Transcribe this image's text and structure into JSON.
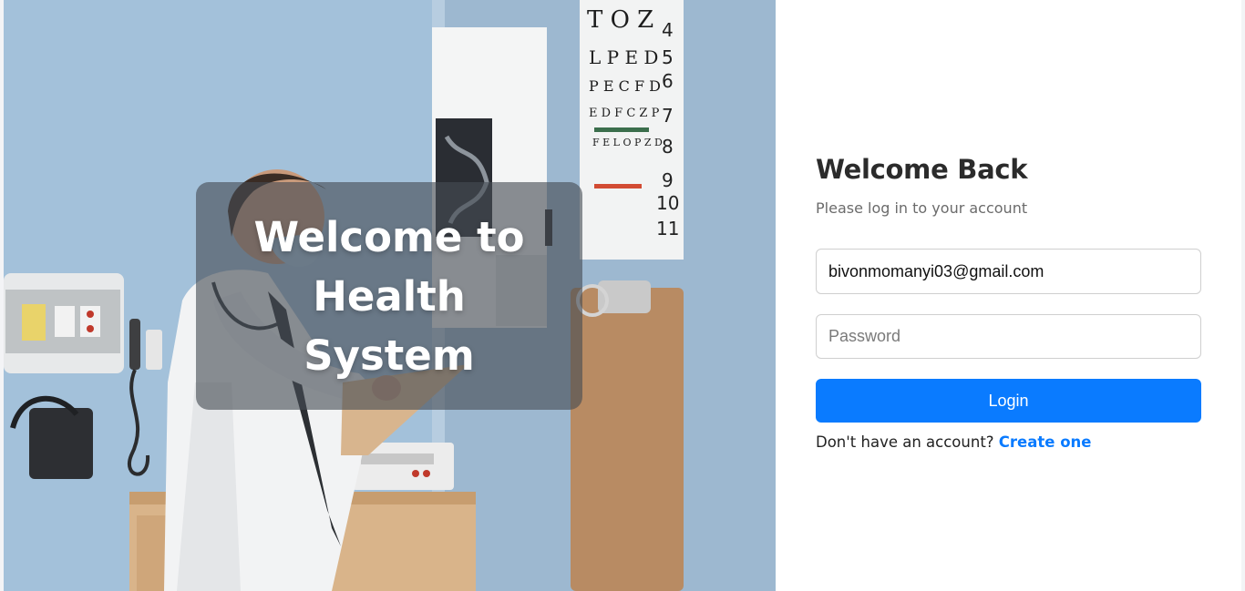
{
  "hero": {
    "title": "Welcome to Health System"
  },
  "login": {
    "heading": "Welcome Back",
    "subheading": "Please log in to your account",
    "email_value": "bivonmomanyi03@gmail.com",
    "password_placeholder": "Password",
    "login_button": "Login",
    "signup_prompt": "Don't have an account?",
    "signup_link": "Create one"
  },
  "colors": {
    "accent": "#0a7bff",
    "overlay": "#464c54",
    "heading": "#2b2b2b"
  }
}
